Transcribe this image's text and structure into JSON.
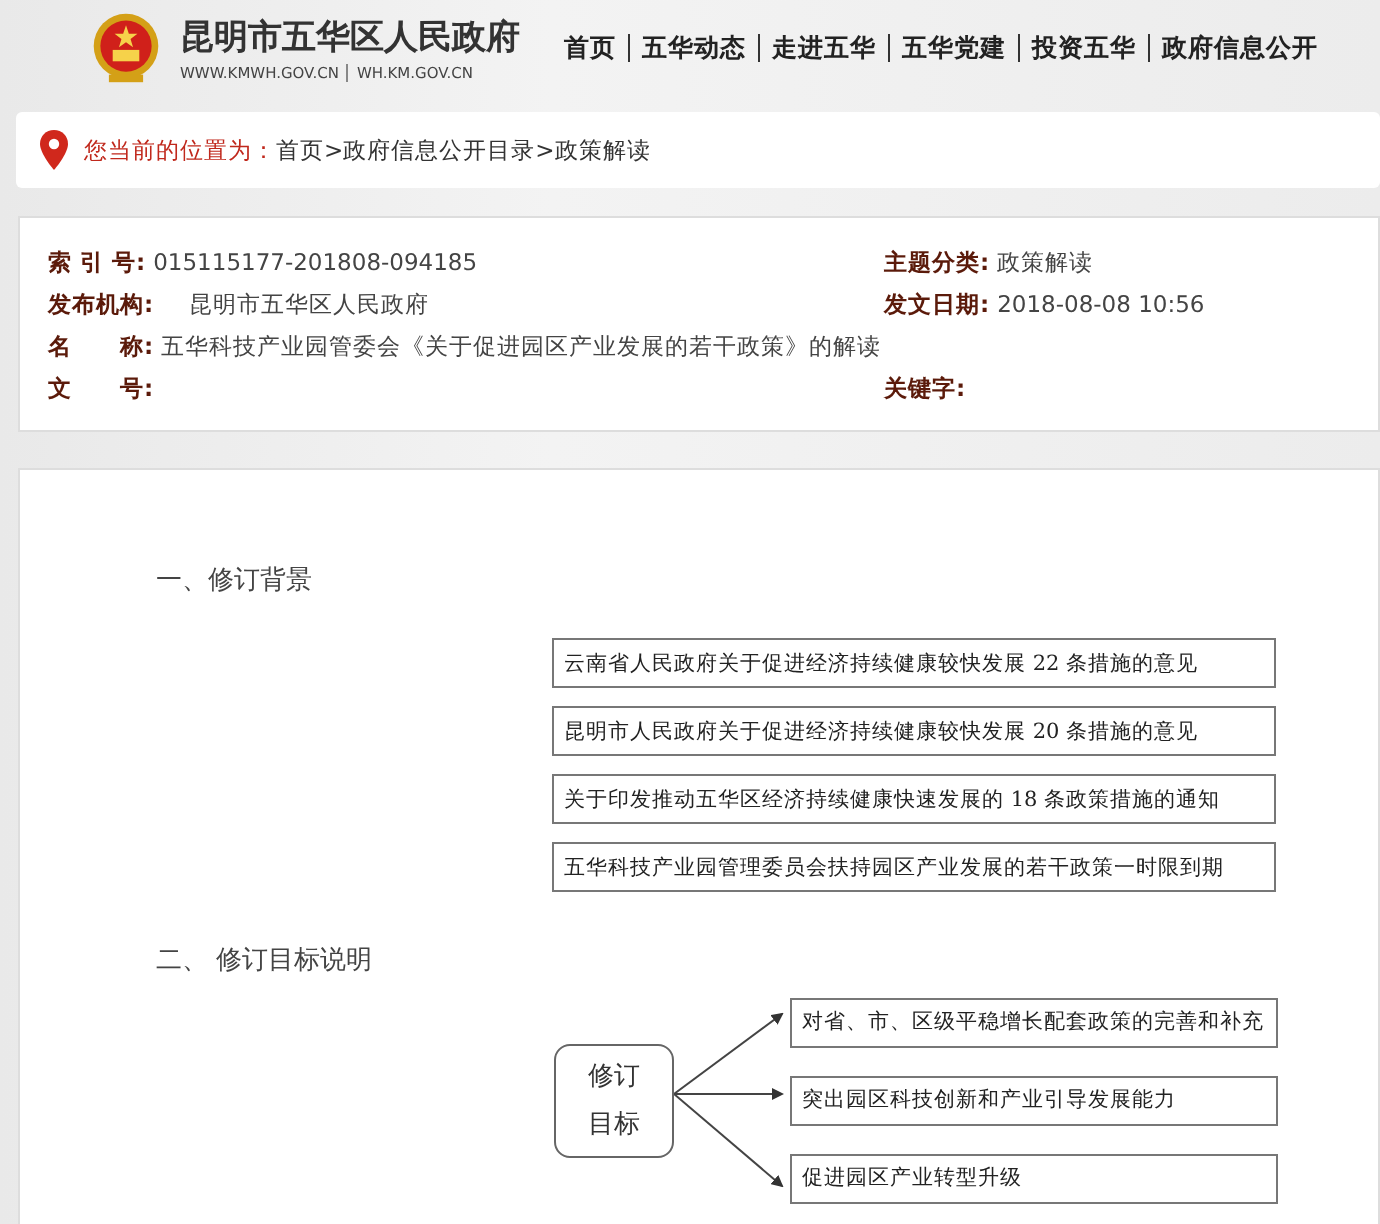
{
  "header": {
    "site_title": "昆明市五华区人民政府",
    "urls": [
      "WWW.KMWH.GOV.CN",
      "WH.KM.GOV.CN"
    ],
    "nav": [
      "首页",
      "五华动态",
      "走进五华",
      "五华党建",
      "投资五华",
      "政府信息公开"
    ]
  },
  "breadcrumb": {
    "label": "您当前的位置为：",
    "separator": ">",
    "items": [
      "首页",
      "政府信息公开目录",
      "政策解读"
    ]
  },
  "info": {
    "left": [
      {
        "label": "索 引 号:",
        "value": "015115177-201808-094185"
      },
      {
        "label": "发布机构:",
        "value": "昆明市五华区人民政府"
      },
      {
        "label": "名　　称:",
        "value": "五华科技产业园管委会《关于促进园区产业发展的若干政策》的解读"
      },
      {
        "label": "文　　号:"
      }
    ],
    "right": [
      {
        "label": "主题分类:",
        "value": "政策解读"
      },
      {
        "label": "发文日期:",
        "value": "2018-08-08 10:56"
      },
      {
        "label": "关键字:"
      }
    ]
  },
  "article": {
    "section_1": {
      "heading": "一、修订背景",
      "boxes": [
        "云南省人民政府关于促进经济持续健康较快发展 22 条措施的意见",
        "昆明市人民政府关于促进经济持续健康较快发展 20 条措施的意见",
        "关于印发推动五华区经济持续健康快速发展的 18 条政策措施的通知",
        "五华科技产业园管理委员会扶持园区产业发展的若干政策一时限到期"
      ]
    },
    "section_2": {
      "heading": "二、 修订目标说明",
      "center": [
        "修订",
        "目标"
      ],
      "boxes": [
        "对省、市、区级平稳增长配套政策的完善和补充",
        "突出园区科技创新和产业引导发展能力",
        "促进园区产业转型升级"
      ]
    }
  }
}
